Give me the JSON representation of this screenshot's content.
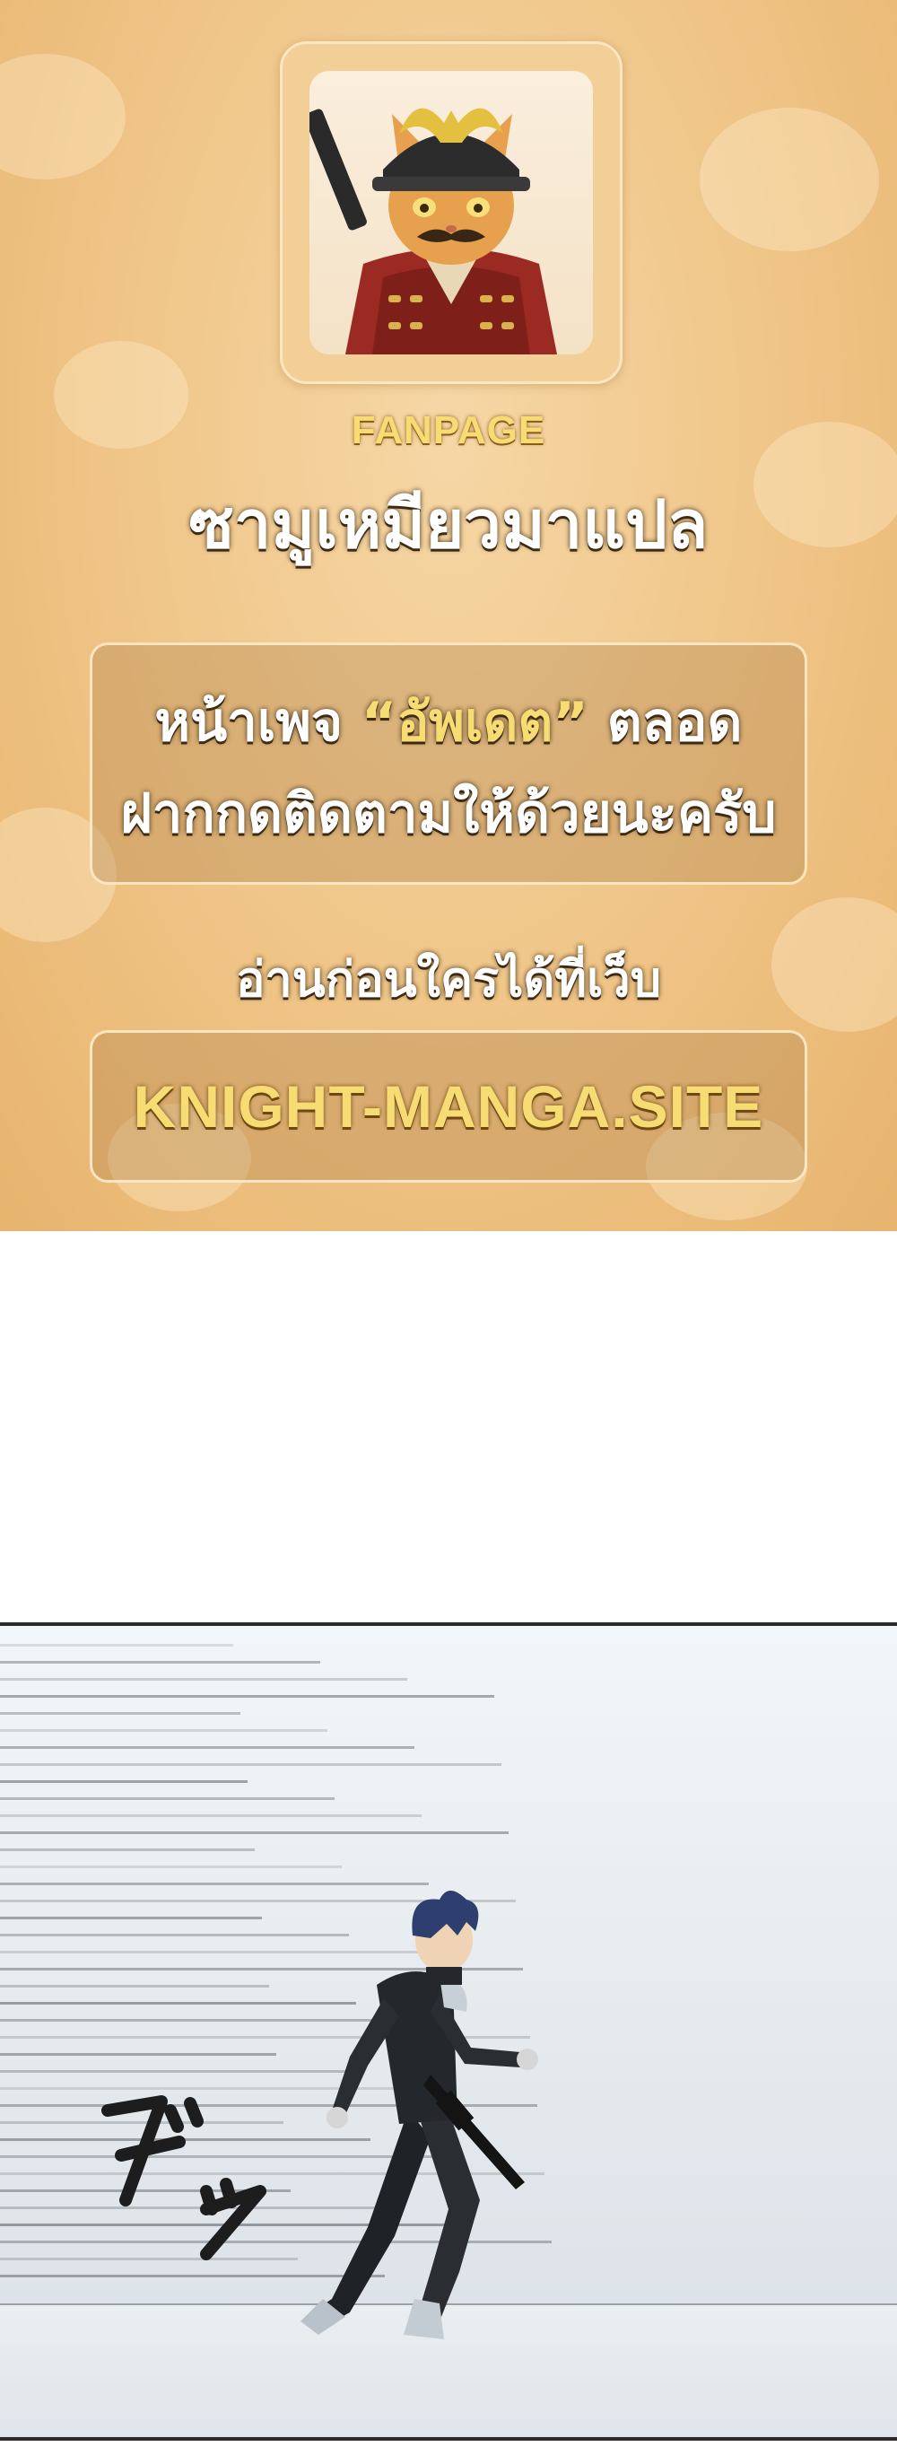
{
  "banner": {
    "fanpage_label": "FANPAGE",
    "page_name": "ซามูเหมียวมาแปล",
    "notice_line1_before": "หน้าเพจ ",
    "notice_line1_highlight": "“อัพเดต”",
    "notice_line1_after": " ตลอด",
    "notice_line2": "ฝากกดติดตามให้ด้วยนะครับ",
    "read_first": "อ่านก่อนใครได้ที่เว็บ",
    "site": "KNIGHT-MANGA.SITE"
  },
  "colors": {
    "banner_bg": "#efc486",
    "highlight_yellow": "#f7dc74",
    "text_white": "#ffffff"
  },
  "logo": {
    "icon": "samurai-cat-icon"
  },
  "panel": {
    "sfx": "ダッ",
    "character": "running-soldier-figure"
  }
}
